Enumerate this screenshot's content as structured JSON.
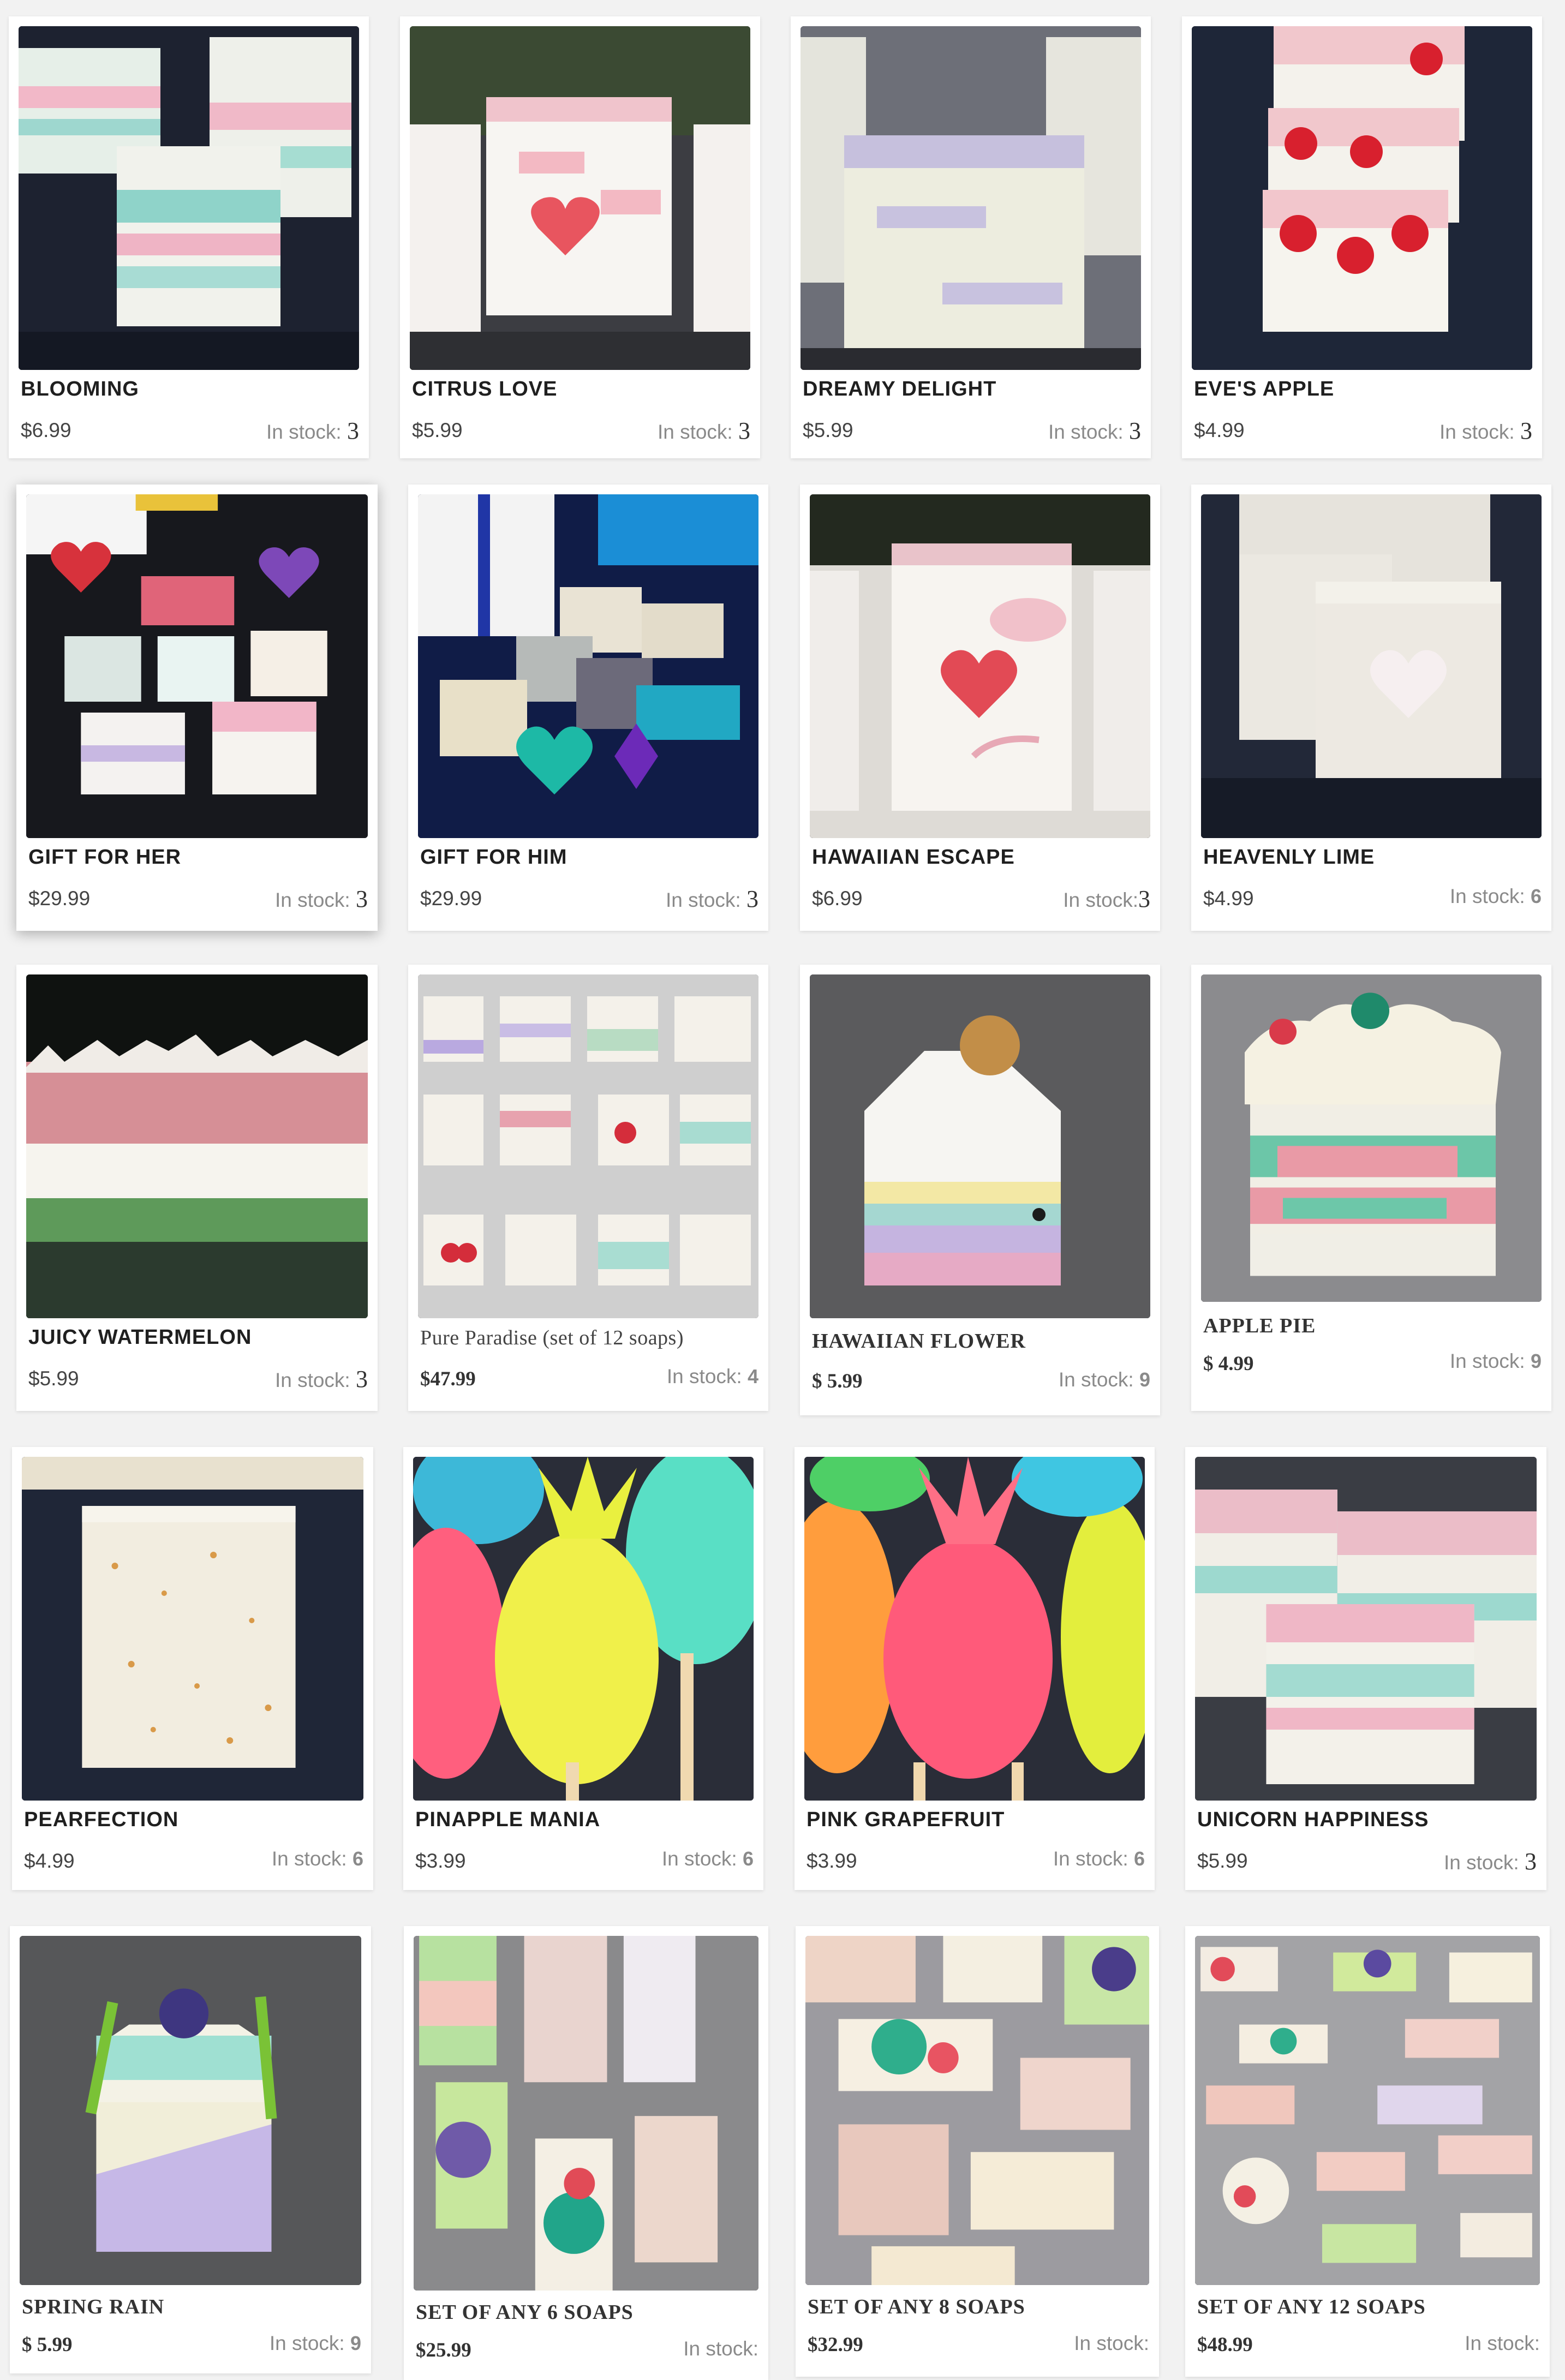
{
  "stock_label": "In stock:",
  "products": [
    {
      "name": "BLOOMING",
      "price": "$6.99",
      "stock": "3",
      "icon": "soap-image"
    },
    {
      "name": "CITRUS LOVE",
      "price": "$5.99",
      "stock": "3",
      "icon": "soap-image"
    },
    {
      "name": "DREAMY DELIGHT",
      "price": "$5.99",
      "stock": "3",
      "icon": "soap-image"
    },
    {
      "name": "EVE'S APPLE",
      "price": "$4.99",
      "stock": "3",
      "icon": "soap-image"
    },
    {
      "name": "GIFT FOR HER",
      "price": "$29.99",
      "stock": "3",
      "icon": "soap-image"
    },
    {
      "name": "GIFT FOR HIM",
      "price": "$29.99",
      "stock": "3",
      "icon": "soap-image"
    },
    {
      "name": "HAWAIIAN ESCAPE",
      "price": "$6.99",
      "stock": "3",
      "icon": "soap-image"
    },
    {
      "name": "HEAVENLY LIME",
      "price": "$4.99",
      "stock": "6",
      "icon": "soap-image"
    },
    {
      "name": "JUICY WATERMELON",
      "price": "$5.99",
      "stock": "3",
      "icon": "soap-image"
    },
    {
      "name": "Pure Paradise (set of 12 soaps)",
      "price": "$47.99",
      "stock": "4",
      "icon": "soap-image"
    },
    {
      "name": "HAWAIIAN FLOWER",
      "price": "$ 5.99",
      "stock": "9",
      "icon": "soap-image"
    },
    {
      "name": "APPLE PIE",
      "price": "$ 4.99",
      "stock": "9",
      "icon": "soap-image"
    },
    {
      "name": "PEARFECTION",
      "price": "$4.99",
      "stock": "6",
      "icon": "soap-image"
    },
    {
      "name": "PINAPPLE MANIA",
      "price": "$3.99",
      "stock": "6",
      "icon": "soap-image"
    },
    {
      "name": "PINK GRAPEFRUIT",
      "price": "$3.99",
      "stock": "6",
      "icon": "soap-image"
    },
    {
      "name": "UNICORN HAPPINESS",
      "price": "$5.99",
      "stock": "3",
      "icon": "soap-image"
    },
    {
      "name": "SPRING RAIN",
      "price": "$ 5.99",
      "stock": "9",
      "icon": "soap-image"
    },
    {
      "name": "SET OF ANY 6 SOAPS",
      "price": "$25.99",
      "stock": "",
      "icon": "soap-image"
    },
    {
      "name": "SET OF ANY 8 SOAPS",
      "price": "$32.99",
      "stock": "",
      "icon": "soap-image"
    },
    {
      "name": "SET OF ANY 12 SOAPS",
      "price": "$48.99",
      "stock": "",
      "icon": "soap-image"
    }
  ]
}
